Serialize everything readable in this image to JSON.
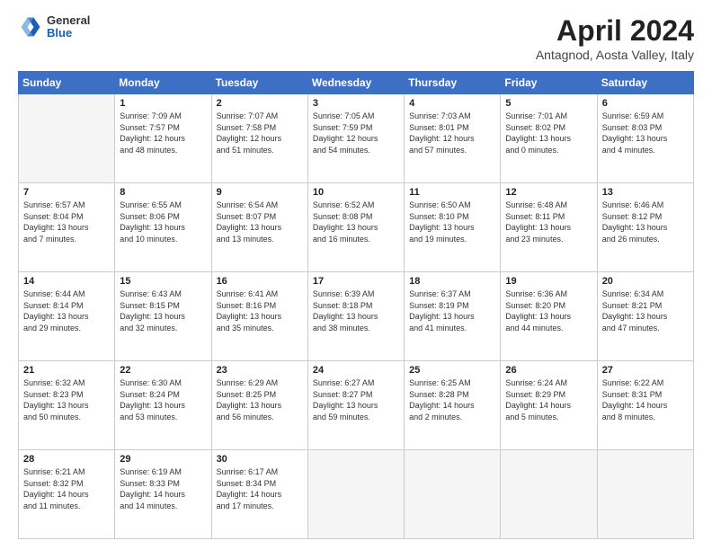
{
  "header": {
    "logo": {
      "general": "General",
      "blue": "Blue"
    },
    "title": "April 2024",
    "location": "Antagnod, Aosta Valley, Italy"
  },
  "days_of_week": [
    "Sunday",
    "Monday",
    "Tuesday",
    "Wednesday",
    "Thursday",
    "Friday",
    "Saturday"
  ],
  "weeks": [
    [
      {
        "day": "",
        "info": ""
      },
      {
        "day": "1",
        "info": "Sunrise: 7:09 AM\nSunset: 7:57 PM\nDaylight: 12 hours\nand 48 minutes."
      },
      {
        "day": "2",
        "info": "Sunrise: 7:07 AM\nSunset: 7:58 PM\nDaylight: 12 hours\nand 51 minutes."
      },
      {
        "day": "3",
        "info": "Sunrise: 7:05 AM\nSunset: 7:59 PM\nDaylight: 12 hours\nand 54 minutes."
      },
      {
        "day": "4",
        "info": "Sunrise: 7:03 AM\nSunset: 8:01 PM\nDaylight: 12 hours\nand 57 minutes."
      },
      {
        "day": "5",
        "info": "Sunrise: 7:01 AM\nSunset: 8:02 PM\nDaylight: 13 hours\nand 0 minutes."
      },
      {
        "day": "6",
        "info": "Sunrise: 6:59 AM\nSunset: 8:03 PM\nDaylight: 13 hours\nand 4 minutes."
      }
    ],
    [
      {
        "day": "7",
        "info": "Sunrise: 6:57 AM\nSunset: 8:04 PM\nDaylight: 13 hours\nand 7 minutes."
      },
      {
        "day": "8",
        "info": "Sunrise: 6:55 AM\nSunset: 8:06 PM\nDaylight: 13 hours\nand 10 minutes."
      },
      {
        "day": "9",
        "info": "Sunrise: 6:54 AM\nSunset: 8:07 PM\nDaylight: 13 hours\nand 13 minutes."
      },
      {
        "day": "10",
        "info": "Sunrise: 6:52 AM\nSunset: 8:08 PM\nDaylight: 13 hours\nand 16 minutes."
      },
      {
        "day": "11",
        "info": "Sunrise: 6:50 AM\nSunset: 8:10 PM\nDaylight: 13 hours\nand 19 minutes."
      },
      {
        "day": "12",
        "info": "Sunrise: 6:48 AM\nSunset: 8:11 PM\nDaylight: 13 hours\nand 23 minutes."
      },
      {
        "day": "13",
        "info": "Sunrise: 6:46 AM\nSunset: 8:12 PM\nDaylight: 13 hours\nand 26 minutes."
      }
    ],
    [
      {
        "day": "14",
        "info": "Sunrise: 6:44 AM\nSunset: 8:14 PM\nDaylight: 13 hours\nand 29 minutes."
      },
      {
        "day": "15",
        "info": "Sunrise: 6:43 AM\nSunset: 8:15 PM\nDaylight: 13 hours\nand 32 minutes."
      },
      {
        "day": "16",
        "info": "Sunrise: 6:41 AM\nSunset: 8:16 PM\nDaylight: 13 hours\nand 35 minutes."
      },
      {
        "day": "17",
        "info": "Sunrise: 6:39 AM\nSunset: 8:18 PM\nDaylight: 13 hours\nand 38 minutes."
      },
      {
        "day": "18",
        "info": "Sunrise: 6:37 AM\nSunset: 8:19 PM\nDaylight: 13 hours\nand 41 minutes."
      },
      {
        "day": "19",
        "info": "Sunrise: 6:36 AM\nSunset: 8:20 PM\nDaylight: 13 hours\nand 44 minutes."
      },
      {
        "day": "20",
        "info": "Sunrise: 6:34 AM\nSunset: 8:21 PM\nDaylight: 13 hours\nand 47 minutes."
      }
    ],
    [
      {
        "day": "21",
        "info": "Sunrise: 6:32 AM\nSunset: 8:23 PM\nDaylight: 13 hours\nand 50 minutes."
      },
      {
        "day": "22",
        "info": "Sunrise: 6:30 AM\nSunset: 8:24 PM\nDaylight: 13 hours\nand 53 minutes."
      },
      {
        "day": "23",
        "info": "Sunrise: 6:29 AM\nSunset: 8:25 PM\nDaylight: 13 hours\nand 56 minutes."
      },
      {
        "day": "24",
        "info": "Sunrise: 6:27 AM\nSunset: 8:27 PM\nDaylight: 13 hours\nand 59 minutes."
      },
      {
        "day": "25",
        "info": "Sunrise: 6:25 AM\nSunset: 8:28 PM\nDaylight: 14 hours\nand 2 minutes."
      },
      {
        "day": "26",
        "info": "Sunrise: 6:24 AM\nSunset: 8:29 PM\nDaylight: 14 hours\nand 5 minutes."
      },
      {
        "day": "27",
        "info": "Sunrise: 6:22 AM\nSunset: 8:31 PM\nDaylight: 14 hours\nand 8 minutes."
      }
    ],
    [
      {
        "day": "28",
        "info": "Sunrise: 6:21 AM\nSunset: 8:32 PM\nDaylight: 14 hours\nand 11 minutes."
      },
      {
        "day": "29",
        "info": "Sunrise: 6:19 AM\nSunset: 8:33 PM\nDaylight: 14 hours\nand 14 minutes."
      },
      {
        "day": "30",
        "info": "Sunrise: 6:17 AM\nSunset: 8:34 PM\nDaylight: 14 hours\nand 17 minutes."
      },
      {
        "day": "",
        "info": ""
      },
      {
        "day": "",
        "info": ""
      },
      {
        "day": "",
        "info": ""
      },
      {
        "day": "",
        "info": ""
      }
    ]
  ]
}
